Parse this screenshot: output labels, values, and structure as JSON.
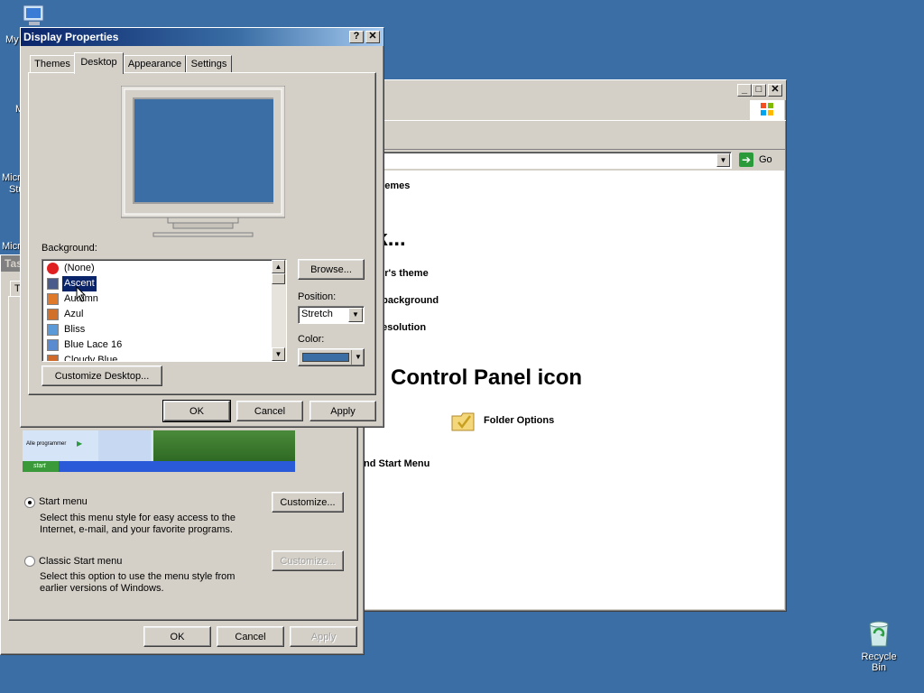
{
  "desktop": {
    "icons": {
      "my_computer_partial": "My",
      "m_partial": "M",
      "micro_partial_1": "Micro",
      "stu_partial": "Stu",
      "micro_partial_2": "Micro",
      "recycle_bin": "Recycle Bin"
    }
  },
  "control_panel": {
    "address_go": "Go",
    "items": {
      "themes_partial": "d Themes",
      "pick_task_partial": "sk...",
      "theme_partial": "puter's theme",
      "background_partial": "top background",
      "resolution_partial": "en resolution",
      "icon_heading": "Control Panel icon",
      "folder_options": "Folder Options",
      "start_menu_partial": "nd Start Menu"
    }
  },
  "taskbar_props": {
    "title_partial": "Tas",
    "tab_partial": "T",
    "preview": {
      "programs": "Alle programmer",
      "start": "start"
    },
    "start_menu_label": "Start menu",
    "start_menu_desc_1": "Select this menu style for easy access to the",
    "start_menu_desc_2": "Internet, e-mail, and your favorite programs.",
    "classic_label": "Classic Start menu",
    "classic_desc_1": "Select this option to use the menu style from",
    "classic_desc_2": "earlier versions of Windows.",
    "customize_1": "Customize...",
    "customize_2": "Customize...",
    "ok": "OK",
    "cancel": "Cancel",
    "apply": "Apply"
  },
  "display_props": {
    "title": "Display Properties",
    "help_btn": "?",
    "close_btn": "✕",
    "tabs": [
      "Themes",
      "Desktop",
      "Appearance",
      "Settings"
    ],
    "background_label": "Background:",
    "backgrounds": [
      "(None)",
      "Ascent",
      "Autumn",
      "Azul",
      "Bliss",
      "Blue Lace 16",
      "Cloudy Blue"
    ],
    "selected_background": "Ascent",
    "browse": "Browse...",
    "position_label": "Position:",
    "position_value": "Stretch",
    "color_label": "Color:",
    "color_value": "#3a6ea5",
    "customize_desktop": "Customize Desktop...",
    "ok": "OK",
    "cancel": "Cancel",
    "apply": "Apply"
  }
}
